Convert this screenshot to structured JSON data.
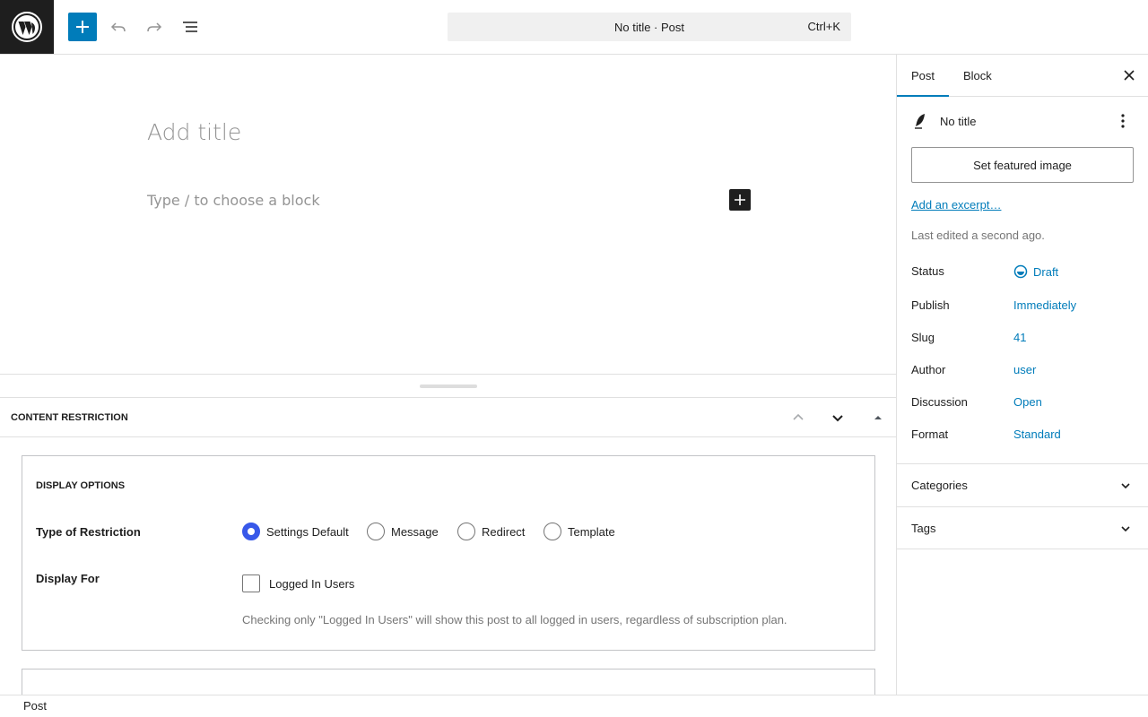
{
  "header": {
    "command_title": "No title · Post",
    "command_shortcut": "Ctrl+K"
  },
  "editor": {
    "title_placeholder": "Add title",
    "block_placeholder": "Type / to choose a block"
  },
  "metabox": {
    "title": "CONTENT RESTRICTION",
    "display_options_title": "DISPLAY OPTIONS",
    "restriction_label": "Type of Restriction",
    "restriction_options": [
      "Settings Default",
      "Message",
      "Redirect",
      "Template"
    ],
    "restriction_selected": "Settings Default",
    "display_for_label": "Display For",
    "logged_in_label": "Logged In Users",
    "logged_in_checked": false,
    "help_text": "Checking only \"Logged In Users\" will show this post to all logged in users, regardless of subscription plan."
  },
  "footer": {
    "breadcrumb": "Post"
  },
  "sidebar": {
    "tabs": [
      {
        "label": "Post",
        "active": true
      },
      {
        "label": "Block",
        "active": false
      }
    ],
    "post_title": "No title",
    "featured_image_label": "Set featured image",
    "excerpt_link": "Add an excerpt…",
    "last_edited": "Last edited a second ago.",
    "meta": [
      {
        "label": "Status",
        "value": "Draft"
      },
      {
        "label": "Publish",
        "value": "Immediately"
      },
      {
        "label": "Slug",
        "value": "41"
      },
      {
        "label": "Author",
        "value": "user"
      },
      {
        "label": "Discussion",
        "value": "Open"
      },
      {
        "label": "Format",
        "value": "Standard"
      }
    ],
    "sections": [
      {
        "label": "Categories"
      },
      {
        "label": "Tags"
      }
    ]
  },
  "colors": {
    "accent": "#007cba",
    "radio_checked": "#3858e9",
    "dark": "#1e1e1e"
  }
}
